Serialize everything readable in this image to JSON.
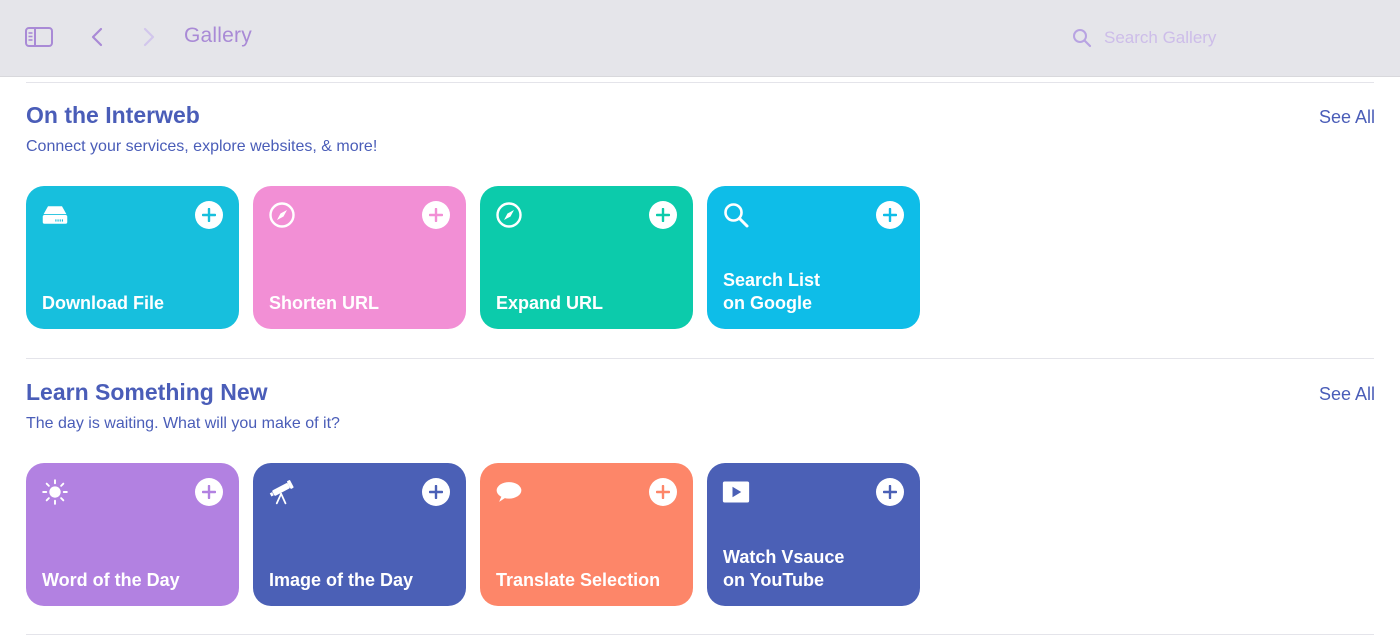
{
  "toolbar": {
    "title": "Gallery",
    "search_placeholder": "Search Gallery"
  },
  "sections": [
    {
      "title": "On the Interweb",
      "subtitle": "Connect your services, explore websites, & more!",
      "see_all": "See All",
      "cards": [
        {
          "label": "Download File",
          "color": "#17bfdd",
          "icon": "download-drive-icon"
        },
        {
          "label": "Shorten URL",
          "color": "#f28fd5",
          "icon": "compass-icon"
        },
        {
          "label": "Expand URL",
          "color": "#0ccbab",
          "icon": "compass-icon"
        },
        {
          "label": "Search List\non Google",
          "color": "#0ebde8",
          "icon": "search-icon"
        }
      ]
    },
    {
      "title": "Learn Something New",
      "subtitle": "The day is waiting. What will you make of it?",
      "see_all": "See All",
      "cards": [
        {
          "label": "Word of the Day",
          "color": "#b281e1",
          "icon": "sun-icon"
        },
        {
          "label": "Image of the Day",
          "color": "#4b60b6",
          "icon": "telescope-icon"
        },
        {
          "label": "Translate Selection",
          "color": "#fd8669",
          "icon": "speech-bubble-icon"
        },
        {
          "label": "Watch Vsauce\non YouTube",
          "color": "#4b60b6",
          "icon": "play-icon"
        }
      ]
    }
  ]
}
